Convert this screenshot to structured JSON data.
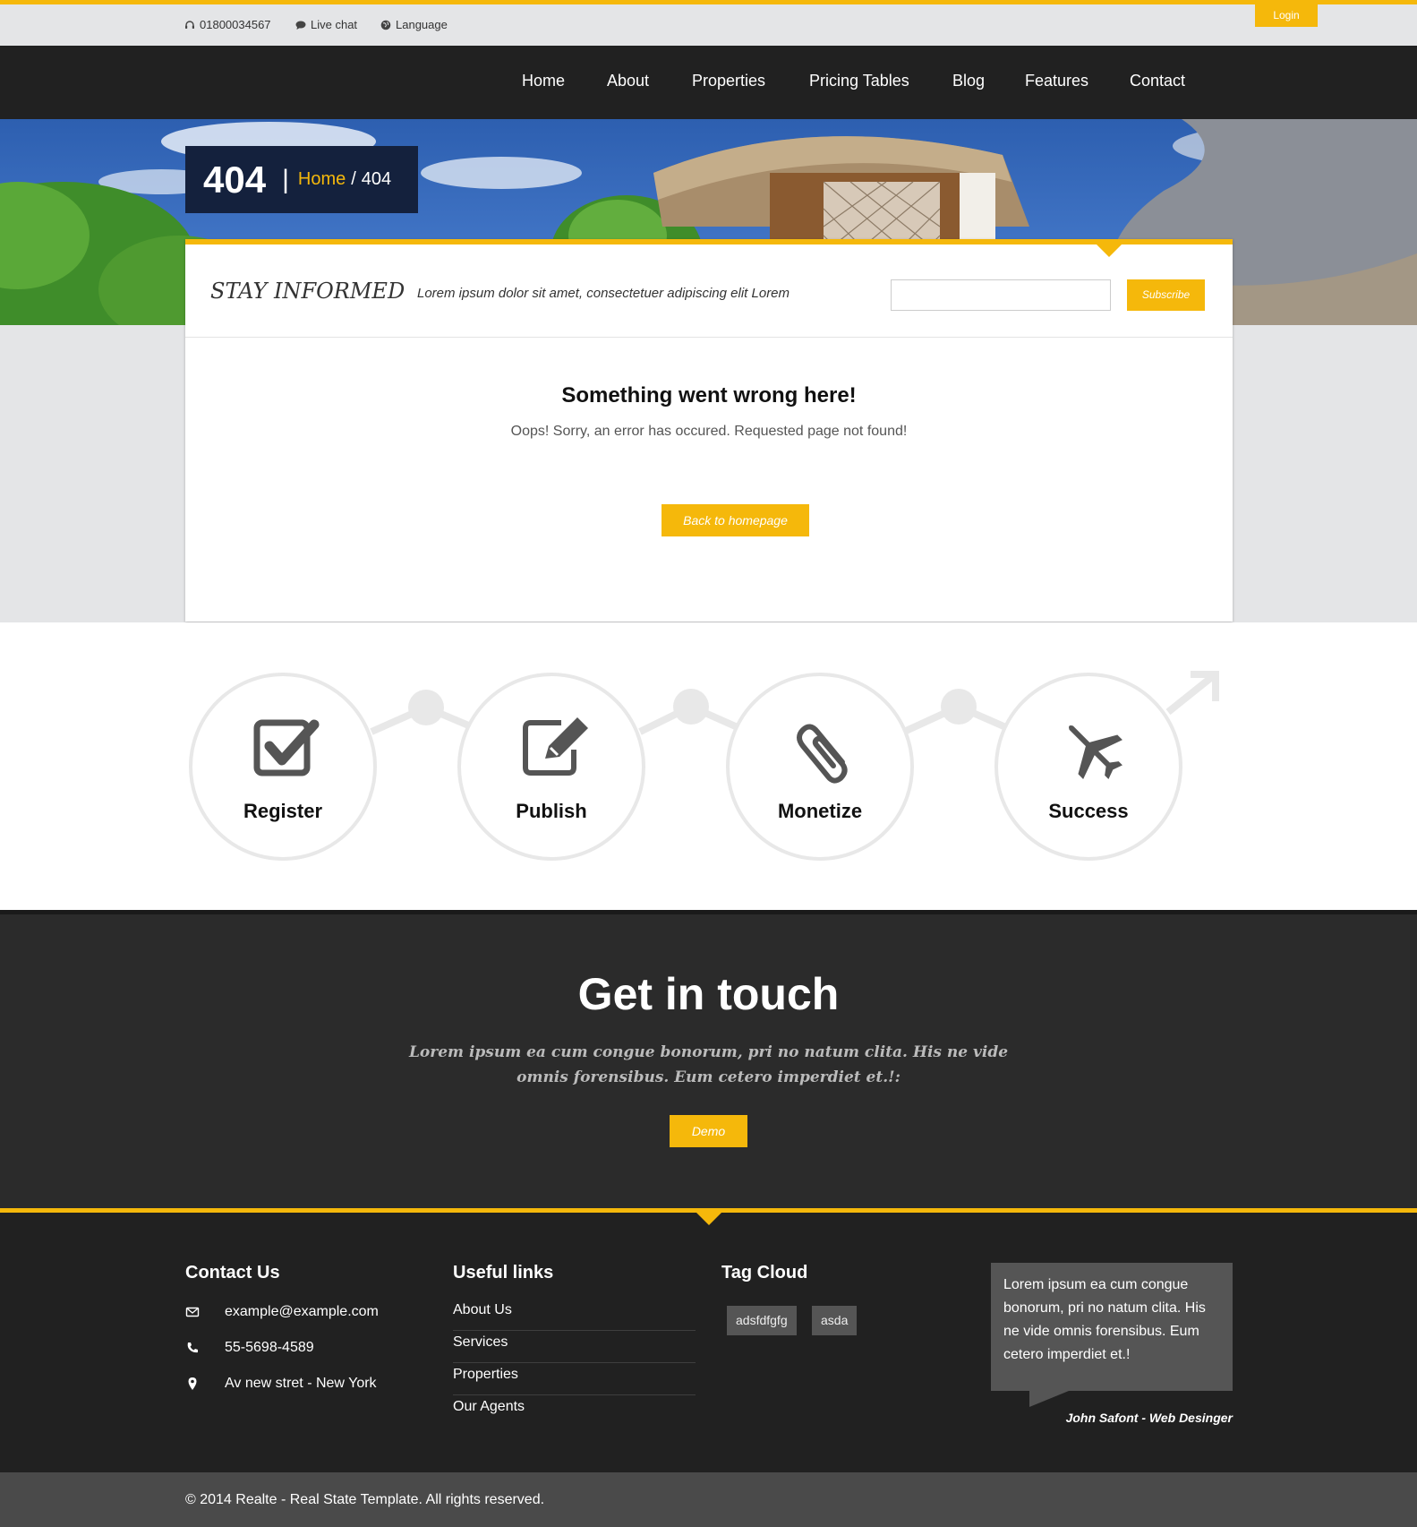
{
  "topbar": {
    "phone": "01800034567",
    "live_chat": "Live chat",
    "language": "Language",
    "login": "Login"
  },
  "nav": {
    "items": [
      "Home",
      "About",
      "Properties",
      "Pricing Tables",
      "Blog",
      "Features",
      "Contact"
    ]
  },
  "page_title": {
    "code": "404",
    "breadcrumb_home": "Home",
    "breadcrumb_sep": "/",
    "breadcrumb_current": "404"
  },
  "newsletter": {
    "title": "STAY INFORMED",
    "subtitle": "Lorem ipsum dolor sit amet, consectetuer adipiscing elit Lorem",
    "email_value": "",
    "subscribe_label": "Subscribe"
  },
  "error": {
    "title": "Something went wrong here!",
    "message": "Oops! Sorry, an error has occured. Requested page not found!",
    "back_label": "Back to homepage"
  },
  "steps": [
    {
      "label": "Register",
      "icon": "check-square-icon"
    },
    {
      "label": "Publish",
      "icon": "edit-icon"
    },
    {
      "label": "Monetize",
      "icon": "paperclip-icon"
    },
    {
      "label": "Success",
      "icon": "plane-icon"
    }
  ],
  "touch": {
    "title": "Get in touch",
    "text": "Lorem ipsum ea cum congue bonorum, pri no natum clita. His ne vide omnis forensibus. Eum cetero imperdiet et.!:",
    "demo_label": "Demo"
  },
  "footer": {
    "contact_title": "Contact Us",
    "email": "example@example.com",
    "phone": "55-5698-4589",
    "address": "Av new stret - New York",
    "links_title": "Useful links",
    "links": [
      "About Us",
      "Services",
      "Properties",
      "Our Agents"
    ],
    "tags_title": "Tag Cloud",
    "tags": [
      "adsfdfgfg",
      "asda"
    ],
    "quote": "Lorem ipsum ea cum congue bonorum, pri no natum clita. His ne vide omnis forensibus. Eum cetero imperdiet et.!",
    "quote_author": "John Safont - Web Desinger",
    "copyright": "© 2014 Realte - Real State Template. All rights reserved."
  },
  "colors": {
    "accent": "#f5b80b",
    "dark": "#212121",
    "title_box": "#14213d",
    "grey_band": "#e4e5e7"
  }
}
